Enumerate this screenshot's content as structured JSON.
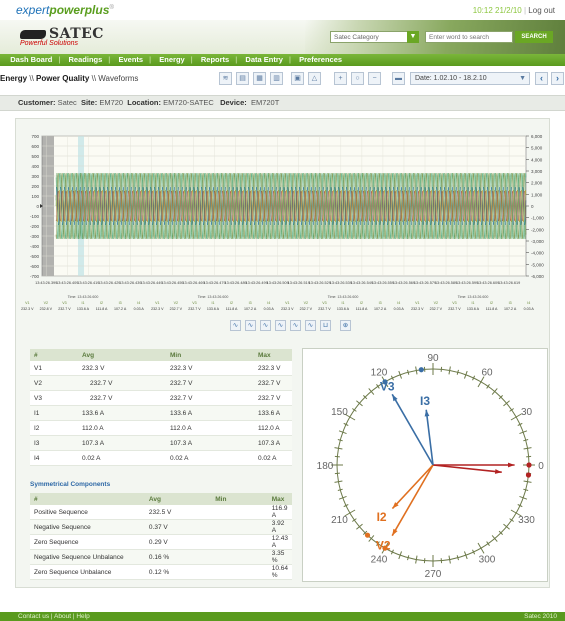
{
  "topbar": {
    "logo_prefix": "expert",
    "logo_suffix": "powerplus",
    "logo_mark": "®",
    "time": "10:12",
    "date": "21/2/10",
    "logout": "Log out"
  },
  "header": {
    "brand": "SATEC",
    "tagline": "Powerful Solutions",
    "category_value": "Satec Category",
    "search_placeholder": "Enter word to search",
    "search_button": "SEARCH"
  },
  "nav": {
    "items": [
      "Dash Board",
      "Readings",
      "Events",
      "Energy",
      "Reports",
      "Data Entry",
      "Preferences"
    ]
  },
  "breadcrumb": {
    "part1": "Energy",
    "part2": "Power Quality",
    "part3": "Waveforms"
  },
  "date_range": "Date: 1.02.10 - 18.2.10",
  "info": {
    "customer_label": "Customer:",
    "customer": "Satec",
    "site_label": "Site:",
    "site": "EM720",
    "location_label": "Location:",
    "location": "EM720-SATEC",
    "device_label": "Device:",
    "device": "EM720T"
  },
  "chart_data": {
    "type": "line",
    "title": "",
    "left_ticks": [
      "700",
      "600",
      "500",
      "400",
      "300",
      "200",
      "100",
      "0",
      "-100",
      "-200",
      "-300",
      "-400",
      "-500",
      "-600",
      "-700"
    ],
    "right_ticks": [
      "6,000",
      "5,000",
      "4,000",
      "3,000",
      "2,000",
      "1,000",
      "0",
      "-1,000",
      "-2,000",
      "-3,000",
      "-4,000",
      "-5,000",
      "-6,000"
    ],
    "ylim_left": [
      -700,
      700
    ],
    "ylim_right": [
      -6000,
      6000
    ],
    "x_ticks": [
      "13:43:26.399",
      "13:43:26.409",
      "13:43:26.419",
      "13:43:26.429",
      "13:43:26.439",
      "13:43:26.449",
      "13:43:26.459",
      "13:43:26.469",
      "13:43:26.479",
      "13:43:26.489",
      "13:43:26.499",
      "13:43:26.509",
      "13:43:26.519",
      "13:43:26.529",
      "13:43:26.539",
      "13:43:26.549",
      "13:43:26.559",
      "13:43:26.569",
      "13:43:26.579",
      "13:43:26.589",
      "13:43:26.599",
      "13:43:26.609",
      "13:43:26.619"
    ],
    "series": [
      {
        "name": "V1",
        "amplitude": 330,
        "color": "#3a8a3a"
      },
      {
        "name": "V2",
        "amplitude": 330,
        "color": "#2f9f6a"
      },
      {
        "name": "V3",
        "amplitude": 330,
        "color": "#5a7a20"
      },
      {
        "name": "I1",
        "amplitude": 190,
        "color": "#1f6f9f"
      },
      {
        "name": "I2",
        "amplitude": 160,
        "color": "#c0a020"
      },
      {
        "name": "I3",
        "amplitude": 150,
        "color": "#b04030"
      }
    ],
    "grid": true
  },
  "channel_groups": [
    {
      "time": "Time: 13:43:26.600",
      "labels": [
        "V1",
        "V2",
        "V3",
        "I1",
        "I2",
        "I3",
        "I4"
      ],
      "values": [
        "232.3 V",
        "232.8 V",
        "232.7 V",
        "133.6 A",
        "111.8 A",
        "107.2 A",
        "0.03 A"
      ]
    },
    {
      "time": "Time: 13:43:26.600",
      "labels": [
        "V1",
        "V2",
        "V3",
        "I1",
        "I2",
        "I3",
        "I4"
      ],
      "values": [
        "232.3 V",
        "232.7 V",
        "232.7 V",
        "133.6 A",
        "111.8 A",
        "107.2 A",
        "0.03 A"
      ]
    },
    {
      "time": "Time: 13:43:26.600",
      "labels": [
        "V1",
        "V2",
        "V3",
        "I1",
        "I2",
        "I3",
        "I4"
      ],
      "values": [
        "232.3 V",
        "232.7 V",
        "232.7 V",
        "133.6 A",
        "111.8 A",
        "107.2 A",
        "0.03 A"
      ]
    },
    {
      "time": "Time: 13:43:26.600",
      "labels": [
        "V1",
        "V2",
        "V3",
        "I1",
        "I2",
        "I3",
        "I4"
      ],
      "values": [
        "232.3 V",
        "232.7 V",
        "232.7 V",
        "133.6 A",
        "111.8 A",
        "107.2 A",
        "0.03 A"
      ]
    }
  ],
  "readings_table": {
    "headers": [
      "#",
      "Avg",
      "Min",
      "Max"
    ],
    "rows": [
      [
        "V1",
        "232.3 V",
        "232.3 V",
        "232.3 V"
      ],
      [
        "V2",
        "232.7 V",
        "232.7 V",
        "232.7 V"
      ],
      [
        "V3",
        "232.7 V",
        "232.7 V",
        "232.7 V"
      ],
      [
        "I1",
        "133.6 A",
        "133.6 A",
        "133.6 A"
      ],
      [
        "I2",
        "112.0 A",
        "112.0 A",
        "112.0 A"
      ],
      [
        "I3",
        "107.3 A",
        "107.3 A",
        "107.3 A"
      ],
      [
        "I4",
        "0.02 A",
        "0.02 A",
        "0.02 A"
      ]
    ]
  },
  "symmetrical": {
    "title": "Symmetrical Components",
    "headers": [
      "#",
      "Avg",
      "Min",
      "Max"
    ],
    "rows": [
      [
        "Positive Sequence",
        "232.5 V",
        "",
        "116.9 A"
      ],
      [
        "Negative Sequence",
        "0.37 V",
        "",
        "3.92 A"
      ],
      [
        "Zero Sequence",
        "0.29 V",
        "",
        "12.43 A"
      ],
      [
        "Negative Sequence Unbalance",
        "0.16 %",
        "",
        "3.35 %"
      ],
      [
        "Zero Sequence Unbalance",
        "0.12 %",
        "",
        "10.64 %"
      ]
    ]
  },
  "phasor": {
    "angle_labels": [
      "0",
      "30",
      "60",
      "90",
      "120",
      "150",
      "180",
      "210",
      "240",
      "270",
      "300",
      "330"
    ],
    "vectors": [
      {
        "name": "V1",
        "angle": 0,
        "magnitude": 0.85,
        "color": "#b22222",
        "label": ""
      },
      {
        "name": "V2",
        "angle": 240,
        "magnitude": 0.85,
        "color": "#e07020",
        "label": "V2"
      },
      {
        "name": "V3",
        "angle": 120,
        "magnitude": 0.85,
        "color": "#3a6ea5",
        "label": "V3"
      },
      {
        "name": "I1",
        "angle": 354,
        "magnitude": 0.72,
        "color": "#b22222",
        "label": ""
      },
      {
        "name": "I2",
        "angle": 227,
        "magnitude": 0.62,
        "color": "#e07020",
        "label": "I2"
      },
      {
        "name": "I3",
        "angle": 97,
        "magnitude": 0.58,
        "color": "#3a6ea5",
        "label": "I3"
      }
    ]
  },
  "footer": {
    "links": [
      "Contact us",
      "About",
      "Help"
    ],
    "copyright": "Satec 2010"
  }
}
